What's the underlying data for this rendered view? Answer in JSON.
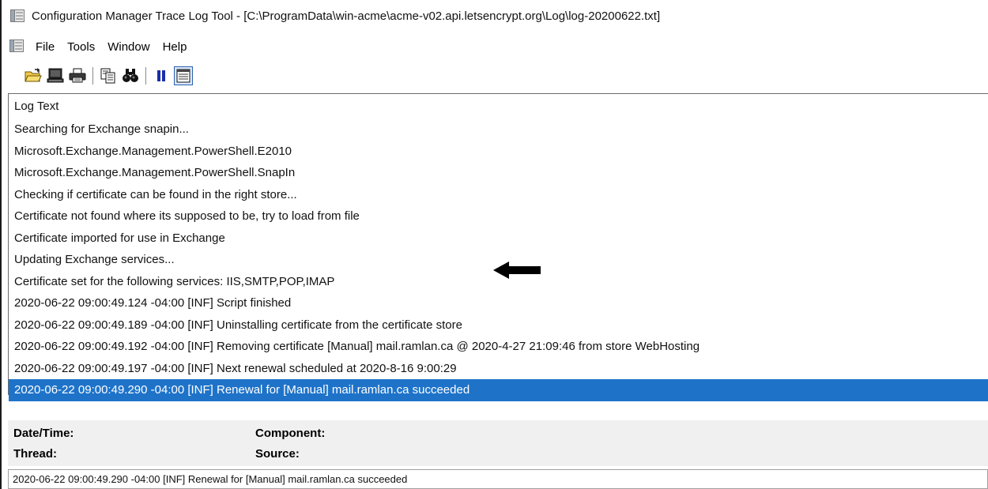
{
  "window": {
    "title": "Configuration Manager Trace Log Tool - [C:\\ProgramData\\win-acme\\acme-v02.api.letsencrypt.org\\Log\\log-20200622.txt]"
  },
  "menu": {
    "items": [
      "File",
      "Tools",
      "Window",
      "Help"
    ]
  },
  "toolbar": {
    "buttons": [
      {
        "icon": "open-folder-icon"
      },
      {
        "icon": "monitor-icon"
      },
      {
        "icon": "printer-icon"
      },
      {
        "icon": "copy-icon"
      },
      {
        "icon": "find-binoculars-icon"
      },
      {
        "icon": "pause-icon"
      },
      {
        "icon": "log-view-icon",
        "pressed": true
      }
    ]
  },
  "log": {
    "column_header": "Log Text",
    "rows": [
      "Searching for Exchange snapin...",
      "Microsoft.Exchange.Management.PowerShell.E2010",
      "Microsoft.Exchange.Management.PowerShell.SnapIn",
      "Checking if certificate can be found in the right store...",
      "Certificate not found where its supposed to be, try to load from file",
      "Certificate imported for use in Exchange",
      "Updating Exchange services...",
      "Certificate set for the following services: IIS,SMTP,POP,IMAP",
      "2020-06-22 09:00:49.124 -04:00 [INF] Script finished",
      "2020-06-22 09:00:49.189 -04:00 [INF] Uninstalling certificate from the certificate store",
      "2020-06-22 09:00:49.192 -04:00 [INF] Removing certificate [Manual] mail.ramlan.ca @ 2020-4-27 21:09:46 from store WebHosting",
      "2020-06-22 09:00:49.197 -04:00 [INF] Next renewal scheduled at 2020-8-16 9:00:29",
      "2020-06-22 09:00:49.290 -04:00 [INF] Renewal for [Manual] mail.ramlan.ca succeeded"
    ],
    "selected_index": 12,
    "annotated_index": 11
  },
  "details": {
    "datetime_label": "Date/Time:",
    "datetime_value": "",
    "component_label": "Component:",
    "component_value": "",
    "thread_label": "Thread:",
    "thread_value": "",
    "source_label": "Source:",
    "source_value": "",
    "message": "2020-06-22 09:00:49.290 -04:00 [INF] Renewal for [Manual] mail.ramlan.ca succeeded"
  },
  "colors": {
    "selection": "#1e73c9",
    "details_background": "#f0f0f0"
  }
}
